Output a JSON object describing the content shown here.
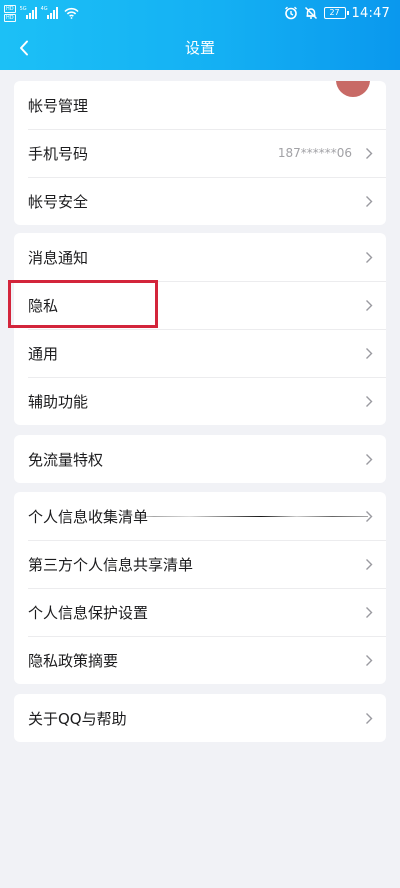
{
  "status_bar": {
    "hd_top": "HD",
    "hd_bottom": "HD",
    "sim1_tag": "5G",
    "sim2_tag": "4G",
    "battery": "27",
    "time": "14:47",
    "icons": [
      "signal-icon",
      "wifi-icon",
      "alarm-icon",
      "mute-bell-icon",
      "battery-icon"
    ]
  },
  "title_bar": {
    "title": "设置",
    "back_icon": "chevron-left-icon"
  },
  "groups": {
    "account": {
      "account_manage": "帐号管理",
      "phone_label": "手机号码",
      "phone_value": "187******06",
      "account_security": "帐号安全"
    },
    "general": {
      "notifications": "消息通知",
      "privacy": "隐私",
      "general": "通用",
      "accessibility": "辅助功能"
    },
    "data": {
      "free_data": "免流量特权"
    },
    "personal_info": {
      "collection_list": "个人信息收集清单",
      "third_party_list": "第三方个人信息共享清单",
      "protection_settings": "个人信息保护设置",
      "privacy_summary": "隐私政策摘要"
    },
    "about": {
      "about_help": "关于QQ与帮助"
    }
  },
  "colors": {
    "header_start": "#1cc0f6",
    "header_end": "#0a98ee",
    "highlight": "#d3253b",
    "background": "#f1f2f6"
  }
}
